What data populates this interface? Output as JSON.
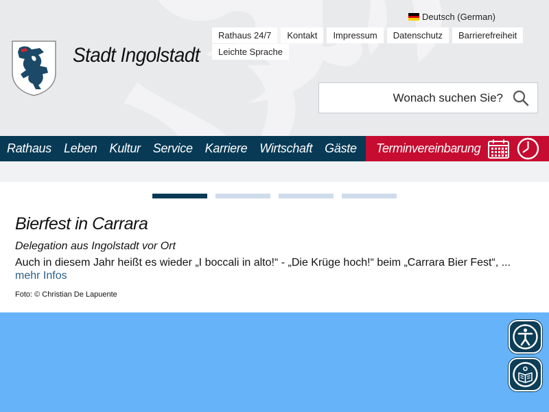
{
  "language": {
    "label": "Deutsch (German)"
  },
  "quick_links": [
    "Rathaus 24/7",
    "Kontakt",
    "Impressum",
    "Datenschutz",
    "Barrierefreiheit",
    "Leichte Sprache"
  ],
  "site": {
    "title": "Stadt Ingolstadt"
  },
  "search": {
    "placeholder": "Wonach suchen Sie?"
  },
  "nav": {
    "items": [
      "Rathaus",
      "Leben",
      "Kultur",
      "Service",
      "Karriere",
      "Wirtschaft",
      "Gäste"
    ],
    "appointment": "Terminvereinbarung"
  },
  "slider": {
    "count": 4,
    "active_index": 0
  },
  "teaser": {
    "title": "Bierfest in Carrara",
    "subtitle": "Delegation aus Ingolstadt vor Ort",
    "text": "Auch in diesem Jahr heißt es wieder „I boccali in alto!“ - „Die Krüge hoch!“ beim „Carrara Bier Fest“, ...",
    "more": "mehr Infos",
    "credit": "Foto: © Christian De Lapuente"
  },
  "colors": {
    "nav_bg": "#083a55",
    "appointment_bg": "#c60c30",
    "link": "#2a5d85",
    "photo_sky": "#66b3fa"
  },
  "icons": [
    "flag-de-icon",
    "search-icon",
    "calendar-icon",
    "clock-icon",
    "accessibility-icon",
    "easy-reading-icon"
  ]
}
